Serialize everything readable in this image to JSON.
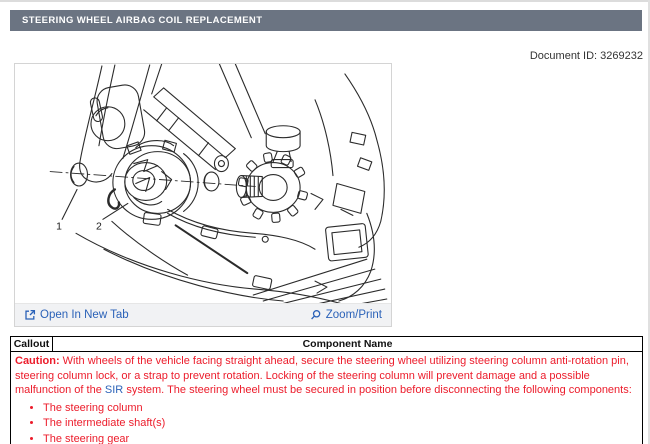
{
  "header": {
    "title": "STEERING WHEEL AIRBAG COIL REPLACEMENT",
    "document_id": "Document ID: 3269232"
  },
  "figure": {
    "callout_1": "1",
    "callout_2": "2",
    "open_in_new_tab_label": "Open In New Tab",
    "zoom_print_label": "Zoom/Print"
  },
  "callout_table": {
    "col_callout": "Callout",
    "col_component": "Component Name",
    "caution_label": "Caution:",
    "caution_before_link": "With wheels of the vehicle facing straight ahead, secure the steering wheel utilizing steering column anti-rotation pin, steering column lock, or a strap to prevent rotation. Locking of the steering column will prevent damage and a possible malfunction of the",
    "caution_link": "SIR",
    "caution_after_link": "system. The steering wheel must be secured in position before disconnecting the following components:",
    "bullets": [
      "The steering column",
      "The intermediate shaft(s)",
      "The steering gear"
    ]
  },
  "colors": {
    "title_bar_bg": "#6b7482",
    "caution_red": "#ec1c2b",
    "link_blue": "#2b62b8"
  }
}
